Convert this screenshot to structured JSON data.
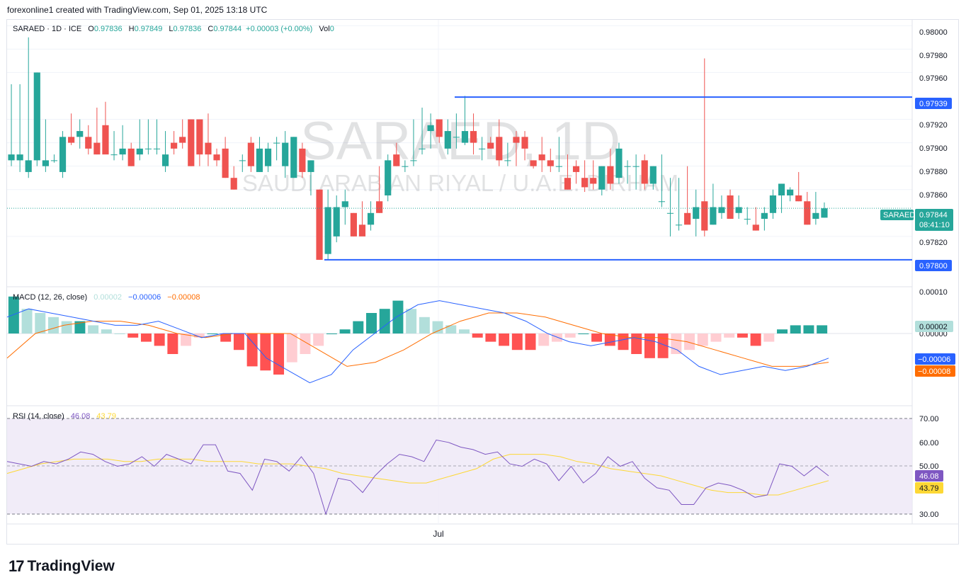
{
  "header": {
    "credit": "forexonline1 created with TradingView.com, Sep 01, 2025 13:18 UTC"
  },
  "watermark": {
    "symbol": "SARAED, 1D",
    "description": "SAUDI ARABIAN RIYAL / U.A.E. DIRHAM"
  },
  "legend": {
    "symbol": "SARAED · 1D · ICE",
    "o_label": "O",
    "o": "0.97836",
    "h_label": "H",
    "h": "0.97849",
    "l_label": "L",
    "l": "0.97836",
    "c_label": "C",
    "c": "0.97844",
    "change": "+0.00003 (+0.00%)",
    "vol_label": "Vol",
    "vol": "0"
  },
  "macd_legend": {
    "label": "MACD (12, 26, close)",
    "hist": "0.00002",
    "macd": "−0.00006",
    "signal": "−0.00008"
  },
  "rsi_legend": {
    "label": "RSI (14, close)",
    "rsi": "46.08",
    "ma": "43.79"
  },
  "price_axis": {
    "ticks": [
      "0.98000",
      "0.97980",
      "0.97960",
      "0.97920",
      "0.97900",
      "0.97880",
      "0.97860",
      "0.97820"
    ],
    "level_top": "0.97939",
    "level_bottom": "0.97800",
    "current_symbol": "SARAED",
    "current_price": "0.97844",
    "countdown": "08:41:10"
  },
  "macd_axis": {
    "ticks": [
      "0.00010",
      "0.00000"
    ],
    "hist_value": "0.00002",
    "macd_value": "−0.00006",
    "signal_value": "−0.00008"
  },
  "rsi_axis": {
    "ticks": [
      "70.00",
      "60.00",
      "50.00",
      "30.00"
    ],
    "rsi_value": "46.08",
    "ma_value": "43.79"
  },
  "time_axis": {
    "label": "Jul"
  },
  "branding": {
    "logo_mark": "17",
    "name": "TradingView"
  },
  "colors": {
    "up": "#26a69a",
    "down": "#ef5350",
    "level_line": "#2962ff",
    "macd_line": "#2962ff",
    "signal_line": "#ff6d00",
    "rsi_line": "#7e57c2",
    "rsi_ma": "#fdd835",
    "rsi_band": "#ede7f6",
    "current_label": "#26a69a"
  },
  "chart_data": {
    "type": "candlestick",
    "series": [
      {
        "name": "SARAED",
        "ohlc": [
          [
            0.97885,
            0.9795,
            0.9788,
            0.9789
          ],
          [
            0.97885,
            0.9795,
            0.97875,
            0.9789
          ],
          [
            0.97875,
            0.9799,
            0.9787,
            0.97885
          ],
          [
            0.97885,
            0.9796,
            0.9788,
            0.9796
          ],
          [
            0.9788,
            0.9792,
            0.97875,
            0.97885
          ],
          [
            0.97885,
            0.9789,
            0.97883,
            0.97885
          ],
          [
            0.97875,
            0.9791,
            0.9787,
            0.97905
          ],
          [
            0.97905,
            0.97925,
            0.97898,
            0.979
          ],
          [
            0.97905,
            0.9792,
            0.97895,
            0.9791
          ],
          [
            0.97905,
            0.97915,
            0.9789,
            0.97895
          ],
          [
            0.979,
            0.9793,
            0.9789,
            0.9789
          ],
          [
            0.97915,
            0.97935,
            0.97895,
            0.9789
          ],
          [
            0.9789,
            0.9791,
            0.97885,
            0.9789
          ],
          [
            0.9789,
            0.97915,
            0.97885,
            0.97895
          ],
          [
            0.97895,
            0.979,
            0.9788,
            0.9788
          ],
          [
            0.9789,
            0.9792,
            0.97885,
            0.97895
          ],
          [
            0.97895,
            0.9792,
            0.9789,
            0.97895
          ],
          [
            0.97895,
            0.9792,
            0.9789,
            0.97895
          ],
          [
            0.9788,
            0.9791,
            0.97875,
            0.9789
          ],
          [
            0.979,
            0.9791,
            0.9789,
            0.97895
          ],
          [
            0.97905,
            0.9792,
            0.97895,
            0.979
          ],
          [
            0.9792,
            0.9792,
            0.9788,
            0.9788
          ],
          [
            0.9792,
            0.9792,
            0.9788,
            0.9789
          ],
          [
            0.979,
            0.97925,
            0.9788,
            0.9789
          ],
          [
            0.9789,
            0.97895,
            0.9788,
            0.97885
          ],
          [
            0.97895,
            0.97905,
            0.9787,
            0.9787
          ],
          [
            0.9787,
            0.9788,
            0.9786,
            0.9786
          ],
          [
            0.97885,
            0.9789,
            0.97875,
            0.97885
          ],
          [
            0.979,
            0.97905,
            0.97875,
            0.9788
          ],
          [
            0.97875,
            0.97905,
            0.97875,
            0.97895
          ],
          [
            0.9788,
            0.979,
            0.97875,
            0.97895
          ],
          [
            0.979,
            0.97905,
            0.97885,
            0.979
          ],
          [
            0.9788,
            0.9791,
            0.9787,
            0.979
          ],
          [
            0.9787,
            0.97905,
            0.9787,
            0.97905
          ],
          [
            0.97895,
            0.979,
            0.9787,
            0.97875
          ],
          [
            0.97875,
            0.97885,
            0.97855,
            0.97885
          ],
          [
            0.9786,
            0.9786,
            0.978,
            0.978
          ],
          [
            0.97805,
            0.9786,
            0.978,
            0.97845
          ],
          [
            0.9782,
            0.97855,
            0.97815,
            0.97845
          ],
          [
            0.97845,
            0.9786,
            0.9783,
            0.9785
          ],
          [
            0.9784,
            0.9784,
            0.9782,
            0.9782
          ],
          [
            0.9783,
            0.9785,
            0.97825,
            0.9782
          ],
          [
            0.9783,
            0.9785,
            0.97825,
            0.9784
          ],
          [
            0.9785,
            0.9788,
            0.9784,
            0.9784
          ],
          [
            0.97855,
            0.9789,
            0.9785,
            0.97885
          ],
          [
            0.9789,
            0.979,
            0.9788,
            0.9788
          ],
          [
            0.9788,
            0.97885,
            0.97875,
            0.9788
          ],
          [
            0.97885,
            0.9792,
            0.9788,
            0.97885
          ],
          [
            0.97895,
            0.9793,
            0.9789,
            0.97895
          ],
          [
            0.9791,
            0.97925,
            0.97895,
            0.97915
          ],
          [
            0.9792,
            0.97915,
            0.979,
            0.97905
          ],
          [
            0.97895,
            0.9792,
            0.9789,
            0.9791
          ],
          [
            0.97905,
            0.97925,
            0.97895,
            0.97905
          ],
          [
            0.979,
            0.9794,
            0.97898,
            0.9791
          ],
          [
            0.9791,
            0.97925,
            0.9789,
            0.979
          ],
          [
            0.97895,
            0.97905,
            0.97885,
            0.97895
          ],
          [
            0.979,
            0.97905,
            0.97895,
            0.97895
          ],
          [
            0.97905,
            0.9792,
            0.9788,
            0.97885
          ],
          [
            0.97885,
            0.979,
            0.9788,
            0.97885
          ],
          [
            0.97905,
            0.9791,
            0.9788,
            0.979
          ],
          [
            0.97905,
            0.9791,
            0.97885,
            0.97895
          ],
          [
            0.97885,
            0.97885,
            0.97878,
            0.9788
          ],
          [
            0.9789,
            0.97905,
            0.97875,
            0.97885
          ],
          [
            0.97885,
            0.97895,
            0.97875,
            0.9788
          ],
          [
            0.9788,
            0.97905,
            0.97875,
            0.9788
          ],
          [
            0.9787,
            0.9789,
            0.9786,
            0.9786
          ],
          [
            0.9788,
            0.97885,
            0.97865,
            0.97875
          ],
          [
            0.9787,
            0.97885,
            0.97858,
            0.97862
          ],
          [
            0.9787,
            0.97885,
            0.9786,
            0.97865
          ],
          [
            0.9786,
            0.9788,
            0.97855,
            0.9788
          ],
          [
            0.9788,
            0.97895,
            0.9786,
            0.97865
          ],
          [
            0.9787,
            0.979,
            0.97865,
            0.97895
          ],
          [
            0.9788,
            0.97885,
            0.97865,
            0.9788
          ],
          [
            0.9788,
            0.9789,
            0.9786,
            0.9788
          ],
          [
            0.97885,
            0.9789,
            0.9786,
            0.97865
          ],
          [
            0.97865,
            0.9788,
            0.9786,
            0.9788
          ],
          [
            0.9785,
            0.9789,
            0.97845,
            0.9785
          ],
          [
            0.9784,
            0.9787,
            0.9782,
            0.9784
          ],
          [
            0.9783,
            0.9787,
            0.97825,
            0.9783
          ],
          [
            0.9784,
            0.9788,
            0.97835,
            0.9783
          ],
          [
            0.97835,
            0.9786,
            0.9782,
            0.97845
          ],
          [
            0.9785,
            0.97972,
            0.9782,
            0.97825
          ],
          [
            0.9783,
            0.97865,
            0.9783,
            0.97845
          ],
          [
            0.9784,
            0.97855,
            0.97835,
            0.97845
          ],
          [
            0.97855,
            0.9786,
            0.97835,
            0.97835
          ],
          [
            0.9784,
            0.97855,
            0.97835,
            0.97845
          ],
          [
            0.97835,
            0.97845,
            0.9783,
            0.97835
          ],
          [
            0.9783,
            0.97845,
            0.97825,
            0.97825
          ],
          [
            0.97835,
            0.97845,
            0.97825,
            0.9784
          ],
          [
            0.9784,
            0.9786,
            0.97835,
            0.97855
          ],
          [
            0.97855,
            0.97865,
            0.9784,
            0.97865
          ],
          [
            0.97855,
            0.97862,
            0.9785,
            0.9786
          ],
          [
            0.97855,
            0.97875,
            0.9785,
            0.9785
          ],
          [
            0.9785,
            0.97858,
            0.9783,
            0.9783
          ],
          [
            0.97835,
            0.97858,
            0.9783,
            0.9784
          ],
          [
            0.97836,
            0.97849,
            0.97836,
            0.97844
          ]
        ]
      }
    ],
    "levels": [
      0.97939,
      0.978
    ],
    "ylim": [
      0.9778,
      0.98005
    ],
    "macd": {
      "hist": [
        9e-05,
        6e-05,
        5e-05,
        4e-05,
        3e-05,
        3e-05,
        2e-05,
        1e-05,
        0.0,
        -1e-05,
        -2e-05,
        -3e-05,
        -5e-05,
        -3e-05,
        -1e-05,
        0.0,
        -2e-05,
        -4e-05,
        -8e-05,
        -9e-05,
        -0.0001,
        -7e-05,
        -5e-05,
        -3e-05,
        0.0,
        1e-05,
        3e-05,
        5e-05,
        6e-05,
        8e-05,
        6e-05,
        4e-05,
        3e-05,
        2e-05,
        1e-05,
        -1e-05,
        -2e-05,
        -3e-05,
        -4e-05,
        -4e-05,
        -3e-05,
        -2e-05,
        -1e-05,
        0.0,
        -2e-05,
        -3e-05,
        -4e-05,
        -5e-05,
        -6e-05,
        -6e-05,
        -5e-05,
        -4e-05,
        -3e-05,
        -2e-05,
        -1e-05,
        -1e-05,
        -3e-05,
        -2e-05,
        1e-05,
        2e-05,
        2e-05,
        2e-05
      ],
      "macd_line": [
        4e-05,
        6e-05,
        5e-05,
        4e-05,
        3e-05,
        2e-05,
        2e-05,
        3e-05,
        1e-05,
        -1e-05,
        0.0,
        0.0,
        -6e-05,
        -9e-05,
        -0.00012,
        -0.0001,
        -4e-05,
        0.0,
        4e-05,
        7e-05,
        8e-05,
        7e-05,
        6e-05,
        5e-05,
        3e-05,
        0.0,
        -2e-05,
        -3e-05,
        -2e-05,
        -1e-05,
        -2e-05,
        -4e-05,
        -8e-05,
        -0.0001,
        -9e-05,
        -8e-05,
        -9e-05,
        -8e-05,
        -6e-05
      ],
      "signal_line": [
        -6e-05,
        0.0,
        2e-05,
        3e-05,
        3e-05,
        2e-05,
        0.0,
        -1e-05,
        0.0,
        0.0,
        0.0,
        -4e-05,
        -8e-05,
        -7e-05,
        -4e-05,
        0.0,
        3e-05,
        5e-05,
        5e-05,
        4e-05,
        2e-05,
        0.0,
        -1e-05,
        -1e-05,
        -2e-05,
        -4e-05,
        -6e-05,
        -8e-05,
        -8e-05,
        -7e-05
      ]
    },
    "rsi": {
      "values": [
        52,
        51,
        50,
        52,
        51,
        53,
        56,
        55,
        52,
        50,
        51,
        54,
        50,
        55,
        53,
        51,
        59,
        59,
        48,
        47,
        40,
        53,
        52,
        48,
        54,
        47,
        30,
        45,
        44,
        39,
        46,
        51,
        55,
        54,
        52,
        61,
        60,
        58,
        57,
        55,
        56,
        51,
        50,
        53,
        51,
        44,
        50,
        43,
        47,
        54,
        50,
        52,
        45,
        41,
        40,
        34,
        34,
        41,
        43,
        42,
        40,
        37,
        38,
        51,
        50,
        46,
        50,
        46
      ],
      "ma": [
        47,
        49,
        51,
        52,
        53,
        53,
        53,
        52,
        52,
        53,
        53,
        53,
        52,
        52,
        52,
        51,
        51,
        51,
        50,
        49,
        47,
        46,
        45,
        44,
        43,
        43,
        45,
        47,
        49,
        53,
        55,
        55,
        55,
        54,
        52,
        51,
        49,
        48,
        47,
        46,
        44,
        42,
        40,
        39,
        39,
        38,
        38,
        40,
        42,
        44
      ],
      "ylim": [
        25,
        75
      ]
    }
  }
}
